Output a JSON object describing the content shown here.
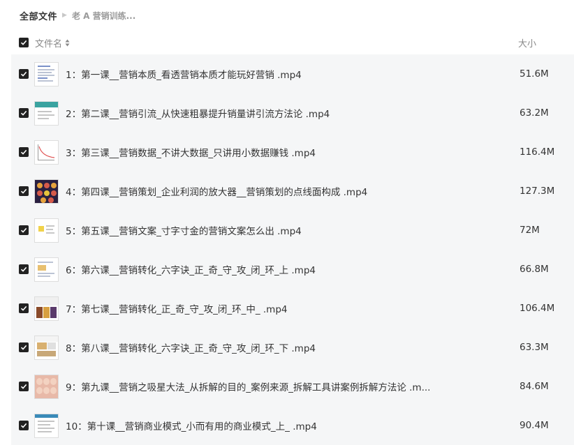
{
  "breadcrumb": {
    "root": "全部文件",
    "current": "老 A 营销训练..."
  },
  "header": {
    "name_label": "文件名",
    "size_label": "大小",
    "all_selected": true
  },
  "files": [
    {
      "name": "1：第一课__营销本质_看透营销本质才能玩好营销 .mp4",
      "size": "51.6M",
      "checked": true,
      "thumb": "doc"
    },
    {
      "name": "2：第二课__营销引流_从快速粗暴提升销量讲引流方法论 .mp4",
      "size": "63.2M",
      "checked": true,
      "thumb": "teal"
    },
    {
      "name": "3：第三课__营销数据_不讲大数据_只讲用小数据赚钱 .mp4",
      "size": "116.4M",
      "checked": true,
      "thumb": "chart"
    },
    {
      "name": "4：第四课__营销策划_企业利润的放大器__营销策划的点线面构成 .mp4",
      "size": "127.3M",
      "checked": true,
      "thumb": "dark"
    },
    {
      "name": "5：第五课__营销文案_寸字寸金的营销文案怎么出 .mp4",
      "size": "72M",
      "checked": true,
      "thumb": "yellow"
    },
    {
      "name": "6：第六课__营销转化_六字诀_正_奇_守_攻_闭_环_上 .mp4",
      "size": "66.8M",
      "checked": true,
      "thumb": "doc2"
    },
    {
      "name": "7：第七课__营销转化_正_奇_守_攻_闭_环_中_ .mp4",
      "size": "106.4M",
      "checked": true,
      "thumb": "photo"
    },
    {
      "name": "8：第八课__营销转化_六字诀_正_奇_守_攻_闭_环_下 .mp4",
      "size": "63.3M",
      "checked": true,
      "thumb": "photo2"
    },
    {
      "name": "9：第九课__营销之吸星大法_从拆解的目的_案例来源_拆解工具讲案例拆解方法论 .m...",
      "size": "84.6M",
      "checked": true,
      "thumb": "people"
    },
    {
      "name": "10：第十课__营销商业模式_小而有用的商业模式_上_ .mp4",
      "size": "90.4M",
      "checked": true,
      "thumb": "doc3"
    }
  ]
}
